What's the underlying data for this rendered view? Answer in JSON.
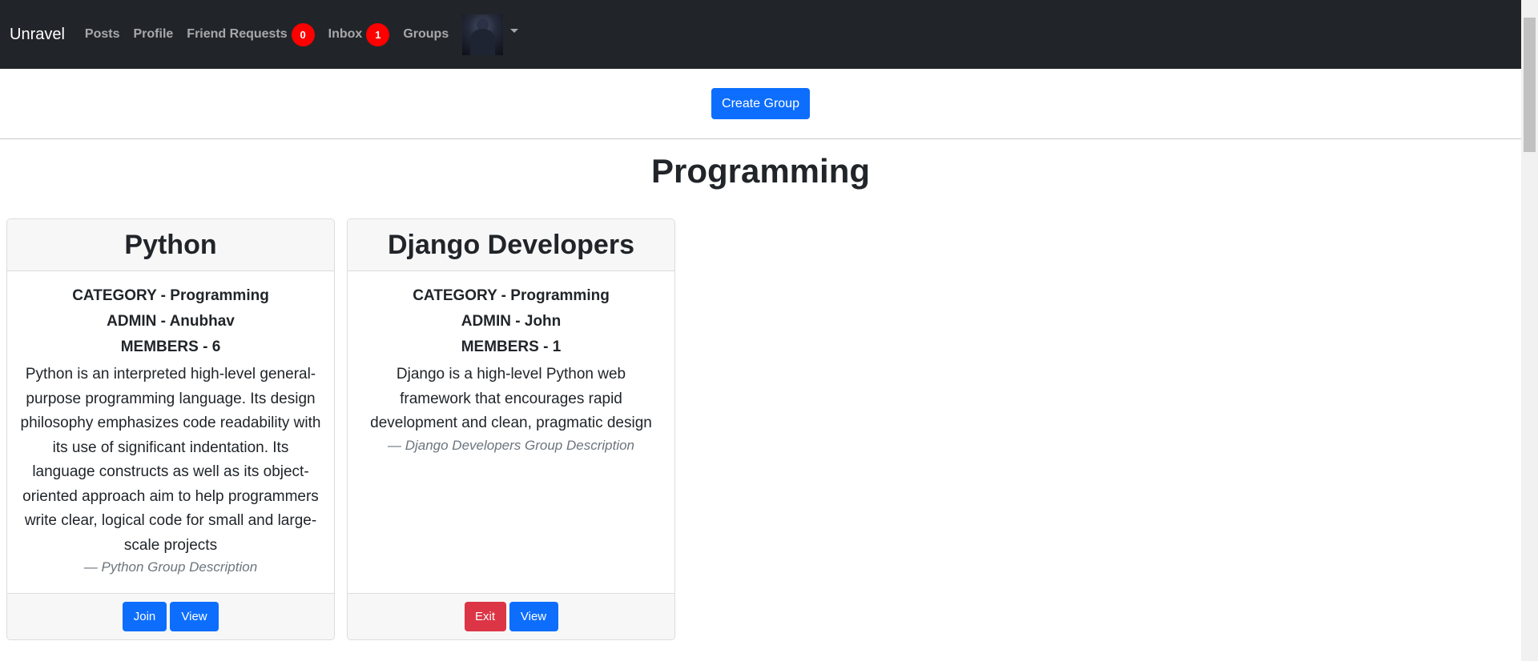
{
  "navbar": {
    "brand": "Unravel",
    "links": {
      "posts": "Posts",
      "profile": "Profile",
      "friend_requests": "Friend Requests",
      "inbox": "Inbox",
      "groups": "Groups"
    },
    "friend_requests_count": "0",
    "inbox_count": "1"
  },
  "toolbar": {
    "create_group_label": "Create Group"
  },
  "category_heading": "Programming",
  "groups": [
    {
      "name": "Python",
      "category": "CATEGORY - Programming",
      "admin": "ADMIN - Anubhav",
      "members": "MEMBERS - 6",
      "description": "Python is an interpreted high-level general-purpose programming language. Its design philosophy emphasizes code readability with its use of significant indentation. Its language constructs as well as its object-oriented approach aim to help programmers write clear, logical code for small and large-scale projects",
      "citation": "— Python Group Description",
      "primary_action": "Join",
      "view_label": "View"
    },
    {
      "name": "Django Developers",
      "category": "CATEGORY - Programming",
      "admin": "ADMIN - John",
      "members": "MEMBERS - 1",
      "description": "Django is a high-level Python web framework that encourages rapid development and clean, pragmatic design",
      "citation": "— Django Developers Group Description",
      "primary_action": "Exit",
      "view_label": "View"
    }
  ],
  "colors": {
    "navbar_bg": "#212529",
    "primary": "#0d6efd",
    "danger": "#dc3545",
    "badge": "#ff0000"
  }
}
